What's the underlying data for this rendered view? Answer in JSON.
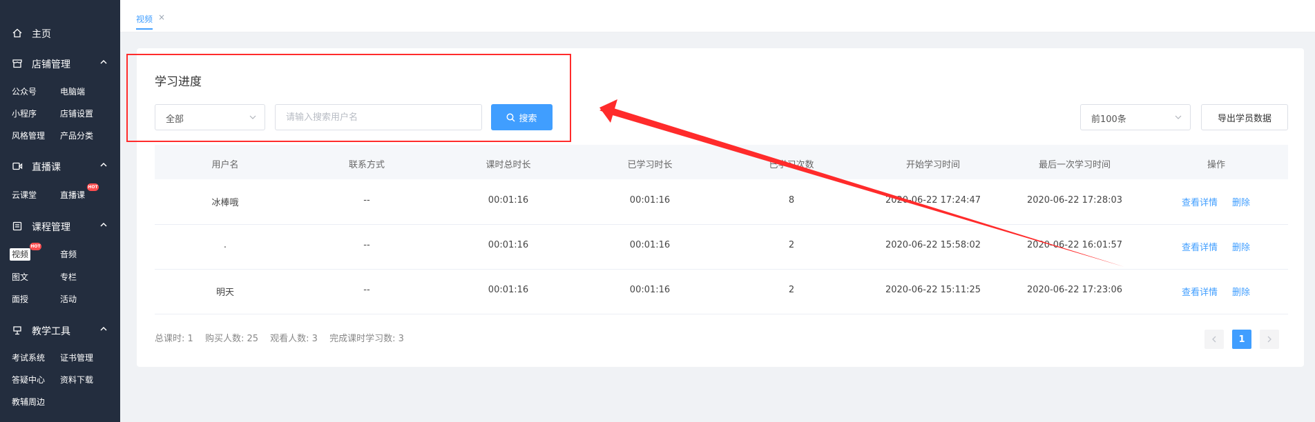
{
  "sidebar": {
    "home": "主页",
    "sections": [
      {
        "label": "店铺管理",
        "items": [
          "公众号",
          "电脑端",
          "小程序",
          "店铺设置",
          "风格管理",
          "产品分类"
        ]
      },
      {
        "label": "直播课",
        "items": [
          "云课堂",
          "直播课"
        ]
      },
      {
        "label": "课程管理",
        "items": [
          "视频",
          "音频",
          "图文",
          "专栏",
          "面授",
          "活动"
        ]
      },
      {
        "label": "教学工具",
        "items": [
          "考试系统",
          "证书管理",
          "答疑中心",
          "资料下载",
          "教辅周边"
        ]
      }
    ],
    "active_item": "视频",
    "hot_badge": "HOT"
  },
  "tabs": [
    {
      "label": "视频"
    }
  ],
  "page": {
    "title": "学习进度",
    "filter_select": "全部",
    "search_placeholder": "请输入搜索用户名",
    "search_value": "",
    "search_button": "搜索",
    "limit_select": "前100条",
    "export_button": "导出学员数据"
  },
  "table": {
    "columns": [
      "用户名",
      "联系方式",
      "课时总时长",
      "已学习时长",
      "已学习次数",
      "开始学习时间",
      "最后一次学习时间",
      "操作"
    ],
    "rows": [
      {
        "user": "冰棒哦",
        "contact": "--",
        "total": "00:01:16",
        "learned": "00:01:16",
        "count": "8",
        "start": "2020-06-22 17:24:47",
        "last": "2020-06-22 17:28:03"
      },
      {
        "user": ".",
        "contact": "--",
        "total": "00:01:16",
        "learned": "00:01:16",
        "count": "2",
        "start": "2020-06-22 15:58:02",
        "last": "2020-06-22 16:01:57"
      },
      {
        "user": "明天",
        "contact": "--",
        "total": "00:01:16",
        "learned": "00:01:16",
        "count": "2",
        "start": "2020-06-22 15:11:25",
        "last": "2020-06-22 17:23:06"
      }
    ],
    "actions": [
      "查看详情",
      "删除"
    ]
  },
  "footer": {
    "stats": [
      "总课时: 1",
      "购买人数: 25",
      "观看人数: 3",
      "完成课时学习数: 3"
    ],
    "current_page": "1"
  },
  "colors": {
    "sidebar_bg": "#232d3e",
    "primary": "#409eff",
    "annotation": "#ff2b2b"
  }
}
